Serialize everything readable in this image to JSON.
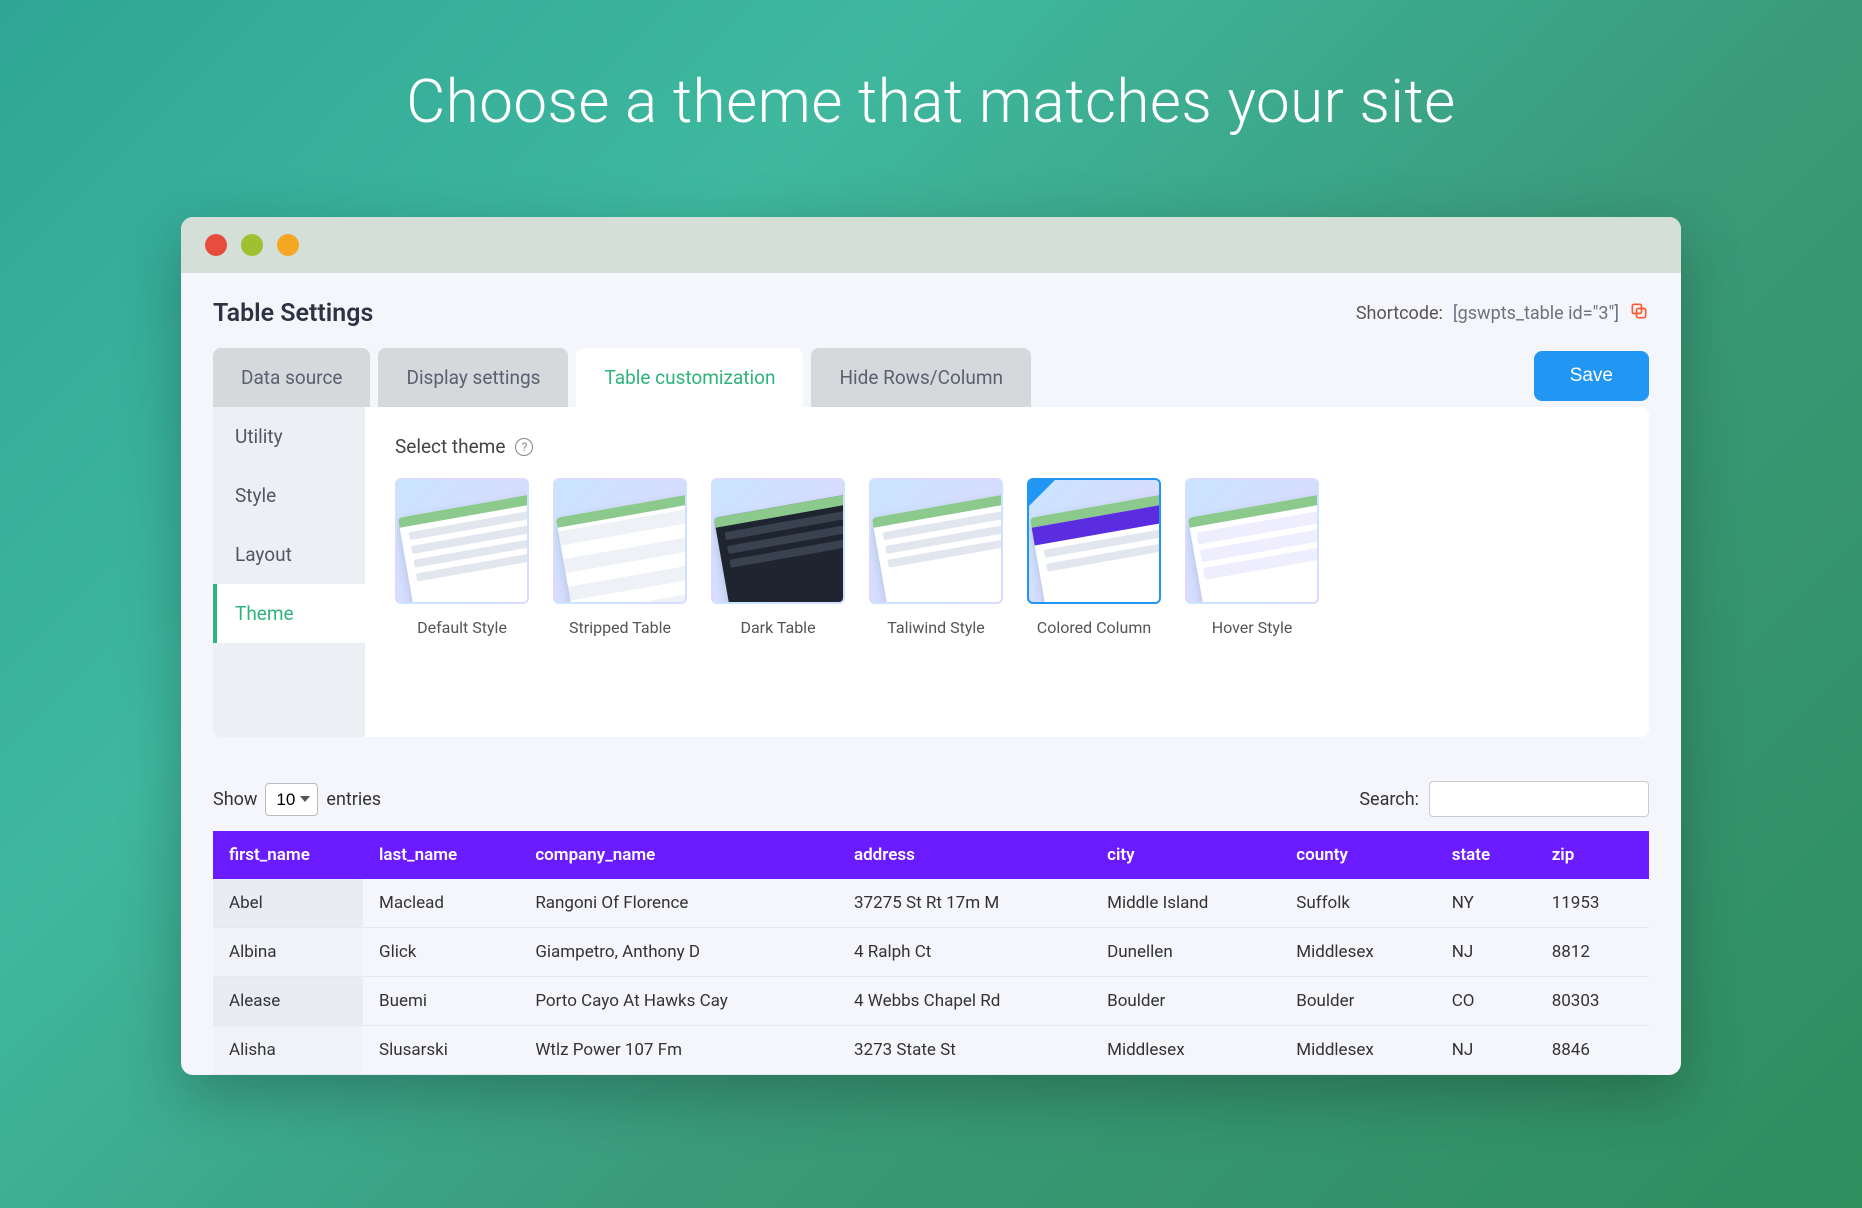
{
  "hero": {
    "title": "Choose a theme that matches your site"
  },
  "header": {
    "page_title": "Table Settings",
    "shortcode_label": "Shortcode:",
    "shortcode_value": "[gswpts_table id=\"3\"]"
  },
  "tabs": {
    "items": [
      {
        "label": "Data source"
      },
      {
        "label": "Display settings"
      },
      {
        "label": "Table customization",
        "active": true
      },
      {
        "label": "Hide Rows/Column"
      }
    ],
    "save_label": "Save"
  },
  "sidenav": {
    "items": [
      {
        "label": "Utility"
      },
      {
        "label": "Style"
      },
      {
        "label": "Layout"
      },
      {
        "label": "Theme",
        "active": true
      }
    ]
  },
  "theme_section": {
    "heading": "Select theme",
    "themes": [
      {
        "label": "Default Style",
        "variant": "default"
      },
      {
        "label": "Stripped Table",
        "variant": "stripe"
      },
      {
        "label": "Dark Table",
        "variant": "dark"
      },
      {
        "label": "Taliwind Style",
        "variant": "tailwind"
      },
      {
        "label": "Colored Column",
        "variant": "colcol",
        "selected": true
      },
      {
        "label": "Hover Style",
        "variant": "hover"
      }
    ]
  },
  "table": {
    "show_label": "Show",
    "entries_label": "entries",
    "entries_value": "10",
    "search_label": "Search:",
    "search_value": "",
    "columns": [
      "first_name",
      "last_name",
      "company_name",
      "address",
      "city",
      "county",
      "state",
      "zip"
    ],
    "rows": [
      [
        "Abel",
        "Maclead",
        "Rangoni Of Florence",
        "37275 St Rt 17m M",
        "Middle Island",
        "Suffolk",
        "NY",
        "11953"
      ],
      [
        "Albina",
        "Glick",
        "Giampetro, Anthony D",
        "4 Ralph Ct",
        "Dunellen",
        "Middlesex",
        "NJ",
        "8812"
      ],
      [
        "Alease",
        "Buemi",
        "Porto Cayo At Hawks Cay",
        "4 Webbs Chapel Rd",
        "Boulder",
        "Boulder",
        "CO",
        "80303"
      ],
      [
        "Alisha",
        "Slusarski",
        "Wtlz Power 107 Fm",
        "3273 State St",
        "Middlesex",
        "Middlesex",
        "NJ",
        "8846"
      ]
    ]
  },
  "colors": {
    "accent": "#2fb47c",
    "save": "#2196f3",
    "table_header": "#6a1bff"
  }
}
